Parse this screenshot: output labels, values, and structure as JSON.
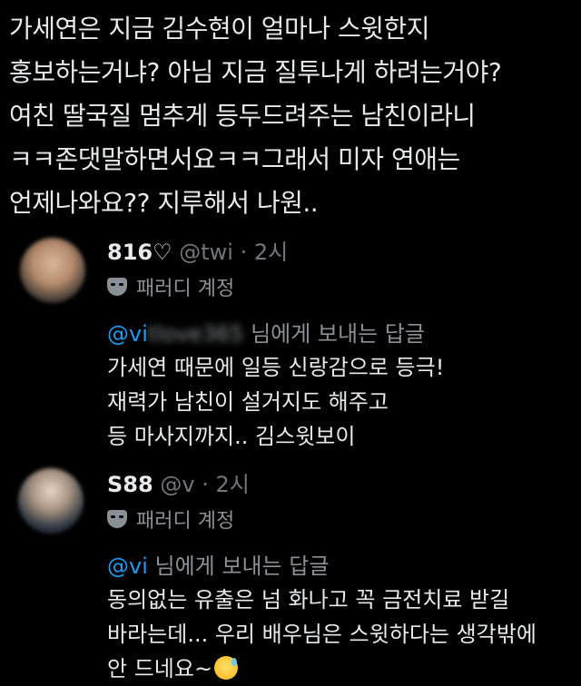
{
  "post": {
    "lines": [
      "가세연은 지금 김수현이 얼마나 스윗한지",
      "홍보하는거냐? 아님 지금 질투나게 하려는거야?",
      "여친 딸국질 멈추게 등두드려주는 남친이라니",
      "ㅋㅋ존댓말하면서요ㅋㅋ그래서 미자 연애는",
      "언제나와요?? 지루해서 나원.."
    ]
  },
  "replies": [
    {
      "name": "8",
      "name_blurred": "",
      "name_suffix": "16♡",
      "handle_visible": "@twi",
      "handle_blurred": "",
      "time": "· 2시",
      "badge": "패러디 계정",
      "reply_to_handle": "@vi",
      "reply_to_blurred": "tlove365",
      "reply_to_suffix": "님에게 보내는 답글",
      "lines": [
        "가세연 때문에 일등 신랑감으로 등극!",
        "재력가 남친이 설거지도 해주고",
        "등 마사지까지..  김스윗보이"
      ]
    },
    {
      "name": "S",
      "name_blurred": "",
      "name_suffix": "88",
      "handle_visible": "@v",
      "handle_blurred": "",
      "time": "· 2시",
      "badge": "패러디 계정",
      "reply_to_handle": "@vi",
      "reply_to_blurred": "",
      "reply_to_suffix": "님에게 보내는 답글",
      "lines": [
        "동의없는 유출은 넘 화나고 꼭 금전치료 받길",
        "바라는데...  우리 배우님은 스윗하다는 생각밖에",
        "안 드네요~"
      ],
      "emoji": "sweat-smile-emoji"
    }
  ],
  "colors": {
    "background": "#000000",
    "text": "#e7e9ea",
    "muted": "#71767b",
    "link": "#1d9bf0"
  }
}
